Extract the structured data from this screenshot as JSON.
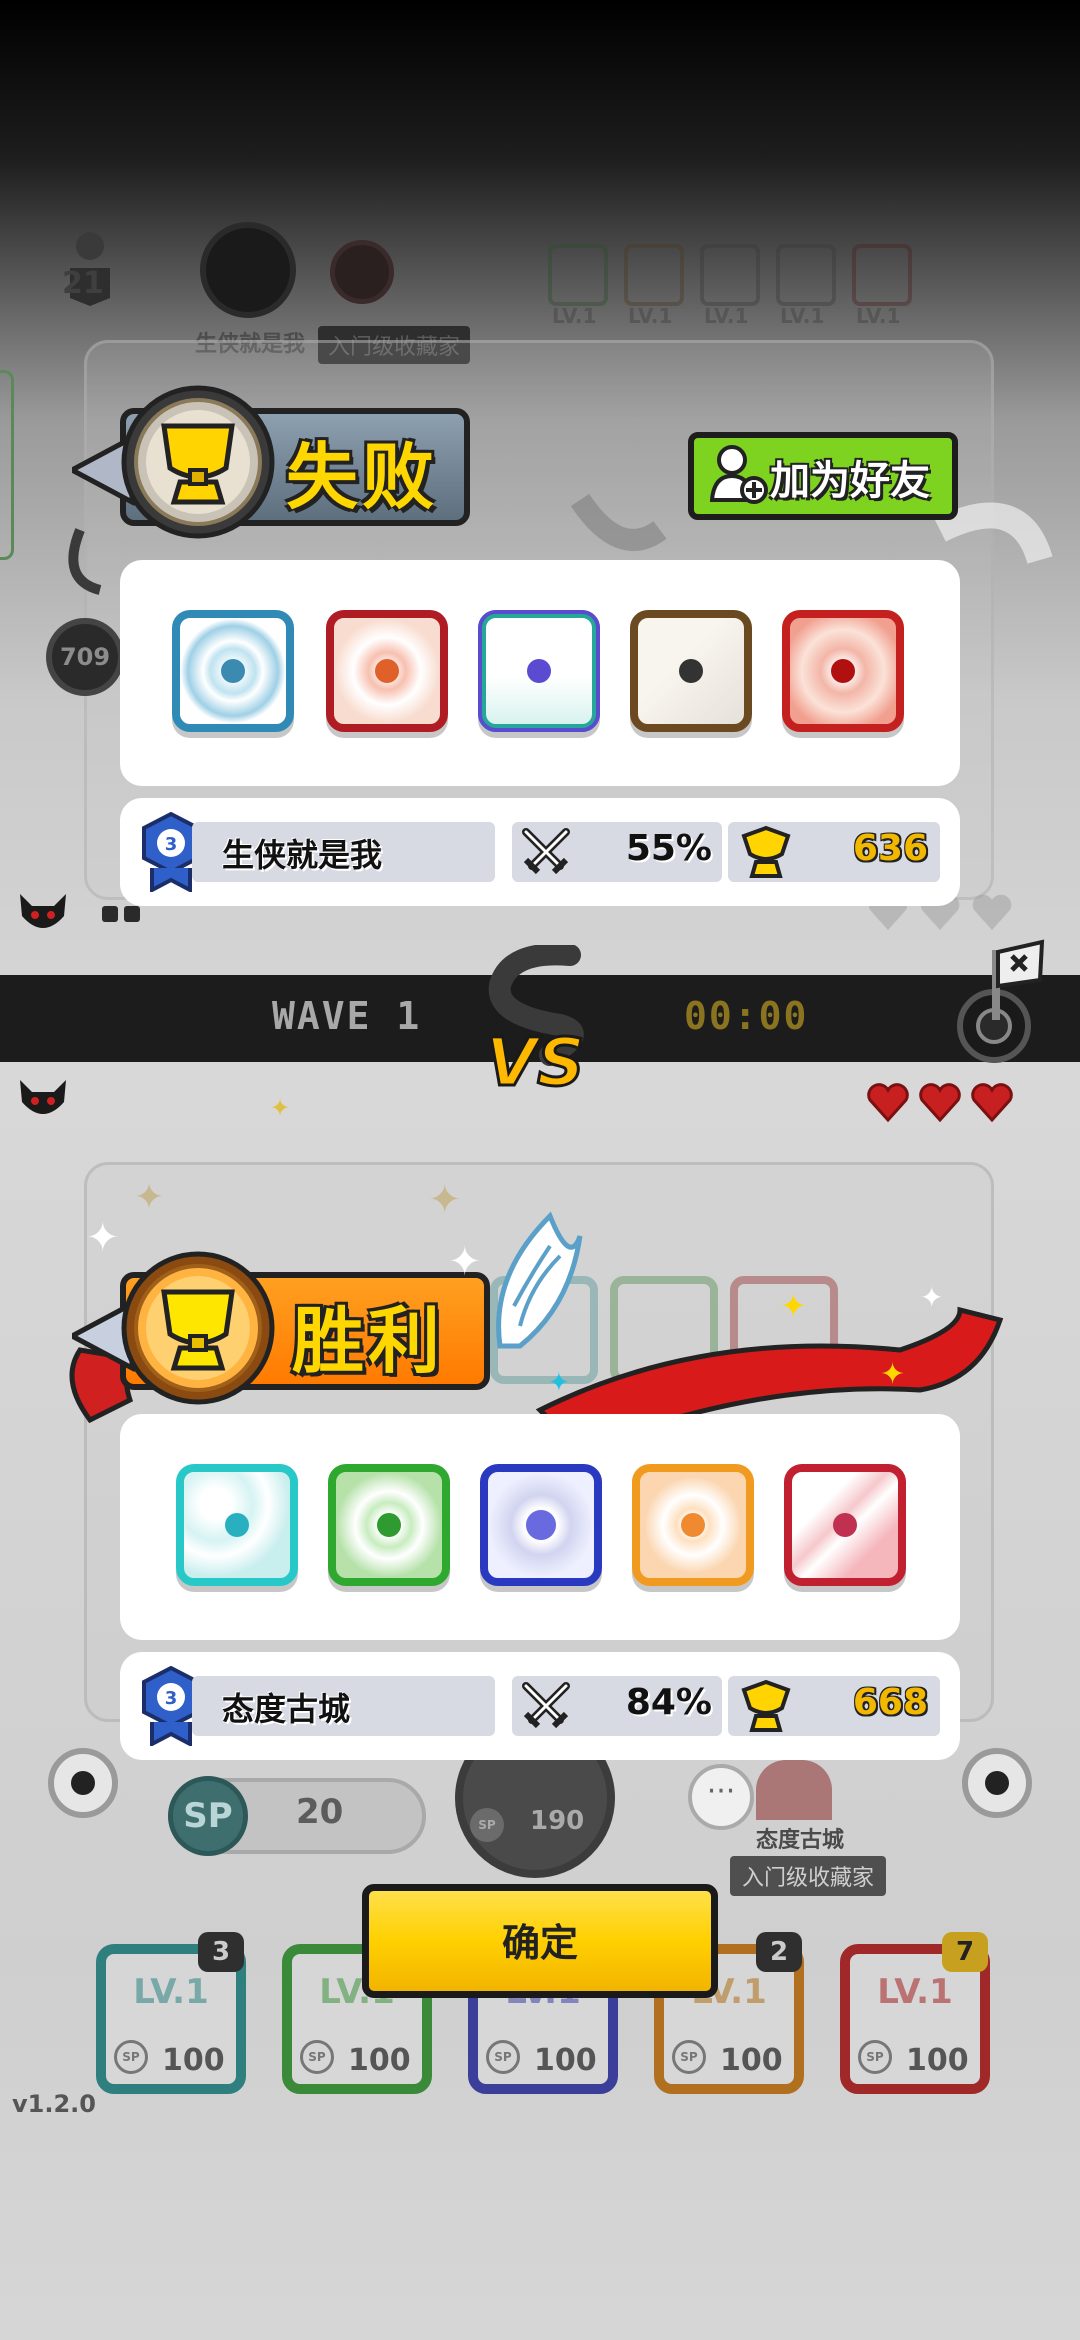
{
  "colors": {
    "win_orange": "#ff8a00",
    "lose_gray": "#6f7f8f",
    "gold": "#ffd700",
    "friend_green": "#7ed321",
    "confirm_yellow": "#ffd000"
  },
  "background": {
    "top_player_level": "21",
    "top_player_name": "生侠就是我",
    "top_player_title": "入门级收藏家",
    "top_slots": [
      "LV.1",
      "LV.1",
      "LV.1",
      "LV.1",
      "LV.1"
    ],
    "left_score": "709",
    "wave_label": "WAVE 1",
    "timer": "00:00",
    "sp_label": "SP",
    "sp_value": "20",
    "dice_sp_label": "SP",
    "dice_cost": "190",
    "chat_label": "···",
    "opponent_name": "态度古城",
    "opponent_title": "入门级收藏家",
    "upgrades": [
      {
        "level": "LV.1",
        "sp": "SP",
        "cost": "100",
        "badge": "3"
      },
      {
        "level": "LV.1",
        "sp": "SP",
        "cost": "100",
        "badge": ""
      },
      {
        "level": "LV.1",
        "sp": "SP",
        "cost": "100",
        "badge": ""
      },
      {
        "level": "LV.1",
        "sp": "SP",
        "cost": "100",
        "badge": "2"
      },
      {
        "level": "LV.1",
        "sp": "SP",
        "cost": "100",
        "badge": "7"
      }
    ],
    "version": "v1.2.0"
  },
  "defeat": {
    "banner_label": "失败",
    "add_friend_label": "加为好友",
    "dice": [
      "wind-dice",
      "fire-star-dice",
      "heal-dice",
      "gun-dice",
      "flame-dice"
    ],
    "rank": "3",
    "player_name": "生侠就是我",
    "win_rate": "55%",
    "trophies": "636"
  },
  "victory": {
    "banner_label": "胜利",
    "dice": [
      "wind-dice",
      "poison-dice",
      "iron-dice",
      "target-dice",
      "lightning-dice"
    ],
    "rank": "3",
    "player_name": "态度古城",
    "win_rate": "84%",
    "trophies": "668"
  },
  "confirm_label": "确定"
}
